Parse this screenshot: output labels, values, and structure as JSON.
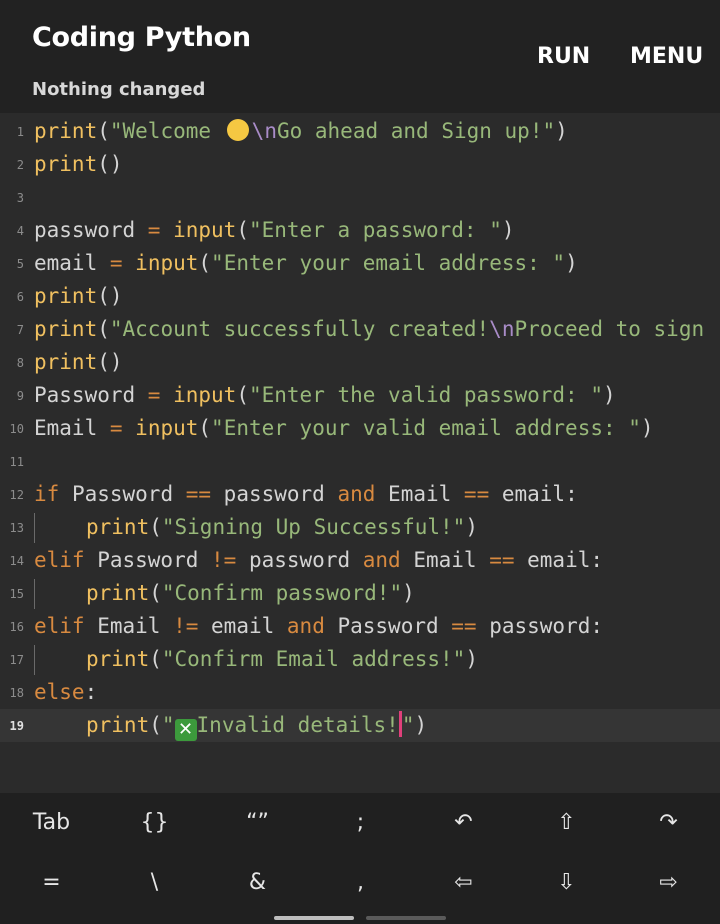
{
  "header": {
    "title": "Coding Python",
    "status": "Nothing changed",
    "run_label": "RUN",
    "menu_label": "MENU"
  },
  "editor": {
    "line_numbers": [
      "1",
      "2",
      "3",
      "4",
      "5",
      "6",
      "7",
      "8",
      "9",
      "10",
      "11",
      "12",
      "13",
      "14",
      "15",
      "16",
      "17",
      "18",
      "19"
    ],
    "lines": {
      "l1": {
        "a": "print",
        "b": "(",
        "c": "\"Welcome ",
        "d": "\\n",
        "e": "Go ahead and Sign up!\"",
        "f": ")"
      },
      "l2": {
        "a": "print",
        "b": "()"
      },
      "l4": {
        "a": "password ",
        "b": "=",
        "c": " ",
        "d": "input",
        "e": "(",
        "f": "\"Enter a password: \"",
        "g": ")"
      },
      "l5": {
        "a": "email ",
        "b": "=",
        "c": " ",
        "d": "input",
        "e": "(",
        "f": "\"Enter your email address: \"",
        "g": ")"
      },
      "l6": {
        "a": "print",
        "b": "()"
      },
      "l7": {
        "a": "print",
        "b": "(",
        "c": "\"Account successfully created!",
        "d": "\\n",
        "e": "Proceed to sign"
      },
      "l8": {
        "a": "print",
        "b": "()"
      },
      "l9": {
        "a": "Password ",
        "b": "=",
        "c": " ",
        "d": "input",
        "e": "(",
        "f": "\"Enter the valid password: \"",
        "g": ")"
      },
      "l10": {
        "a": "Email ",
        "b": "=",
        "c": " ",
        "d": "input",
        "e": "(",
        "f": "\"Enter your valid email address: \"",
        "g": ")"
      },
      "l12": {
        "a": "if",
        "b": " Password ",
        "c": "==",
        "d": " password ",
        "e": "and",
        "f": " Email ",
        "g": "==",
        "h": " email:"
      },
      "l13": {
        "a": "print",
        "b": "(",
        "c": "\"Signing Up Successful!\"",
        "d": ")"
      },
      "l14": {
        "a": "elif",
        "b": " Password ",
        "c": "!=",
        "d": " password ",
        "e": "and",
        "f": " Email ",
        "g": "==",
        "h": " email:"
      },
      "l15": {
        "a": "print",
        "b": "(",
        "c": "\"Confirm password!\"",
        "d": ")"
      },
      "l16": {
        "a": "elif",
        "b": " Email ",
        "c": "!=",
        "d": " email ",
        "e": "and",
        "f": " Password ",
        "g": "==",
        "h": " password:"
      },
      "l17": {
        "a": "print",
        "b": "(",
        "c": "\"Confirm Email address!\"",
        "d": ")"
      },
      "l18": {
        "a": "else",
        "b": ":"
      },
      "l19": {
        "a": "print",
        "b": "(",
        "c": "\"",
        "d": "Invalid details!",
        "e": "\"",
        "f": ")"
      }
    },
    "emojis": {
      "hug": "hugging-face-emoji",
      "x": "cross-mark-emoji"
    }
  },
  "keyboard": {
    "row1": [
      "Tab",
      "{}",
      "“”",
      ";",
      "↶",
      "⇧",
      "↷"
    ],
    "row2": [
      "=",
      "\\",
      "&",
      ",",
      "⇦",
      "⇩",
      "⇨"
    ]
  },
  "colors": {
    "function": "#f0c060",
    "string": "#98b87a",
    "keyword": "#d88a40",
    "escape": "#a98cc8",
    "cursor": "#e0407a"
  }
}
